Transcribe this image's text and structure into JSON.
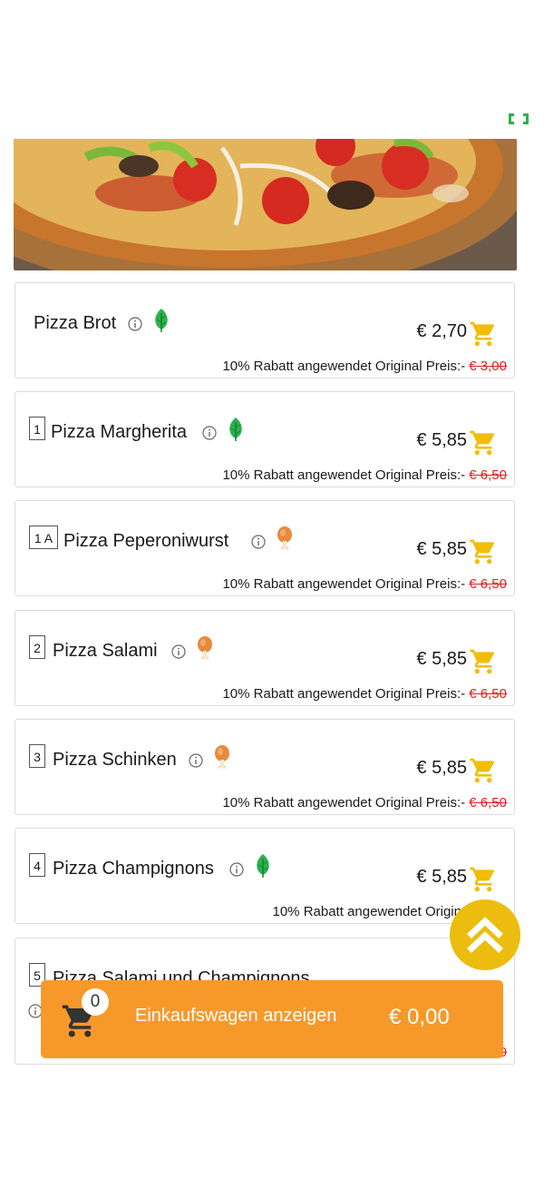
{
  "accent_colors": {
    "cart_bar": "#f7992a",
    "cart_icon": "#f2bd07",
    "scroll_top": "#ecbd0e",
    "strike": "#e02020",
    "vegan": "#2bb24c"
  },
  "hero_image": "pizza-photo",
  "items": [
    {
      "number": "",
      "name": "Pizza Brot",
      "diet_icon": "leaf-icon",
      "price": "€ 2,70",
      "discount_text": "10% Rabatt angewendet Original Preis:-",
      "original_price": "€ 3,00"
    },
    {
      "number": "1",
      "name": "Pizza Margherita",
      "diet_icon": "leaf-icon",
      "price": "€ 5,85",
      "discount_text": "10% Rabatt angewendet Original Preis:-",
      "original_price": "€ 6,50"
    },
    {
      "number": "1 A",
      "name": "Pizza Peperoniwurst",
      "diet_icon": "drumstick-icon",
      "price": "€ 5,85",
      "discount_text": "10% Rabatt angewendet Original Preis:-",
      "original_price": "€ 6,50"
    },
    {
      "number": "2",
      "name": "Pizza Salami",
      "diet_icon": "drumstick-icon",
      "price": "€ 5,85",
      "discount_text": "10% Rabatt angewendet Original Preis:-",
      "original_price": "€ 6,50"
    },
    {
      "number": "3",
      "name": "Pizza Schinken",
      "diet_icon": "drumstick-icon",
      "price": "€ 5,85",
      "discount_text": "10% Rabatt angewendet Original Preis:-",
      "original_price": "€ 6,50"
    },
    {
      "number": "4",
      "name": "Pizza Champignons",
      "diet_icon": "leaf-icon",
      "price": "€ 5,85",
      "discount_text": "10% Rabatt angewendet Original Preis",
      "original_price": ""
    },
    {
      "number": "5",
      "name": "Pizza Salami und Champignons",
      "diet_icon": "",
      "price": "",
      "discount_text": "",
      "original_price": "€ 6,50"
    }
  ],
  "cart_bar": {
    "count": "0",
    "label": "Einkaufswagen anzeigen",
    "total": "€ 0,00"
  }
}
